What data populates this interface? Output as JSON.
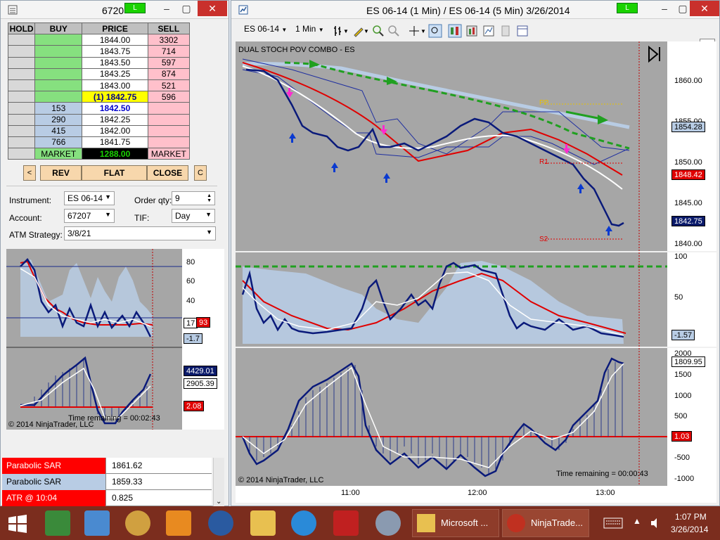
{
  "left_window": {
    "title": "6720",
    "status_label": "L",
    "ladder": {
      "headers": [
        "HOLD",
        "BUY",
        "PRICE",
        "SELL"
      ],
      "rows": [
        {
          "hold": "",
          "buy": "",
          "price": "1844.00",
          "sell": "3302"
        },
        {
          "hold": "",
          "buy": "",
          "price": "1843.75",
          "sell": "714"
        },
        {
          "hold": "",
          "buy": "",
          "price": "1843.50",
          "sell": "597"
        },
        {
          "hold": "",
          "buy": "",
          "price": "1843.25",
          "sell": "874"
        },
        {
          "hold": "",
          "buy": "",
          "price": "1843.00",
          "sell": "521"
        },
        {
          "hold": "",
          "buy": "",
          "price": "(1) 1842.75",
          "sell": "596"
        },
        {
          "hold": "",
          "buy": "153",
          "price": "1842.50",
          "sell": ""
        },
        {
          "hold": "",
          "buy": "290",
          "price": "1842.25",
          "sell": ""
        },
        {
          "hold": "",
          "buy": "415",
          "price": "1842.00",
          "sell": ""
        },
        {
          "hold": "",
          "buy": "766",
          "price": "1841.75",
          "sell": ""
        }
      ],
      "market_buy": "MARKET",
      "market_price": "1288.00",
      "market_sell": "MARKET"
    },
    "buttons": {
      "left": "<",
      "rev": "REV",
      "flat": "FLAT",
      "close": "CLOSE",
      "c": "C"
    },
    "form": {
      "instrument_label": "Instrument:",
      "instrument_value": "ES 06-14",
      "order_qty_label": "Order qty:",
      "order_qty_value": "9",
      "account_label": "Account:",
      "account_value": "67207",
      "tif_label": "TIF:",
      "tif_value": "Day",
      "atm_label": "ATM Strategy:",
      "atm_value": "3/8/21"
    },
    "mini_chart": {
      "stoch_ticks": [
        "80",
        "60",
        "40"
      ],
      "stoch_flag_left": "17",
      "stoch_flag_right": "93",
      "stoch_flag2": "-1.7",
      "osc_flag1": "4429.01",
      "osc_flag2": "2905.39",
      "osc_flag3": "2.08",
      "time_remaining": "Time remaining = 00:02:43",
      "copyright": "© 2014 NinjaTrader, LLC"
    },
    "indicator_table": [
      {
        "name": "Parabolic SAR",
        "value": "1861.62",
        "color": "#ff0000"
      },
      {
        "name": "Parabolic SAR",
        "value": "1859.33",
        "color": "#b8cce4"
      },
      {
        "name": "ATR @ 10:04",
        "value": "0.825",
        "color": "#ff0000"
      }
    ]
  },
  "right_window": {
    "title": "ES 06-14 (1 Min) / ES 06-14 (5 Min)  3/26/2014",
    "status_label": "L",
    "toolbar": {
      "instrument": "ES 06-14",
      "interval": "1 Min"
    },
    "chart_title": "DUAL STOCH POV COMBO - ES",
    "price_ticks": [
      "1860.00",
      "1855.00",
      "1850.00",
      "1845.00",
      "1840.00"
    ],
    "price_flags": {
      "upper": "1854.28",
      "red": "1848.42",
      "current": "1842.75"
    },
    "labels": {
      "pp": "PP",
      "s2": "S2",
      "r1": "R1"
    },
    "stoch_ticks": [
      "100",
      "50"
    ],
    "stoch_flag": "-1.57",
    "osc_ticks": [
      "2000",
      "1500",
      "1000",
      "500",
      "0",
      "-500",
      "-1000"
    ],
    "osc_flags": {
      "top": "1809.95",
      "red": "1.03"
    },
    "time_remaining": "Time remaining = 00:00:43",
    "copyright": "© 2014 NinjaTrader, LLC",
    "time_axis": [
      "11:00",
      "12:00",
      "13:00"
    ]
  },
  "taskbar": {
    "apps": [
      "Microsoft ...",
      "NinjaTrade..."
    ],
    "time": "1:07 PM",
    "date": "3/26/2014"
  }
}
